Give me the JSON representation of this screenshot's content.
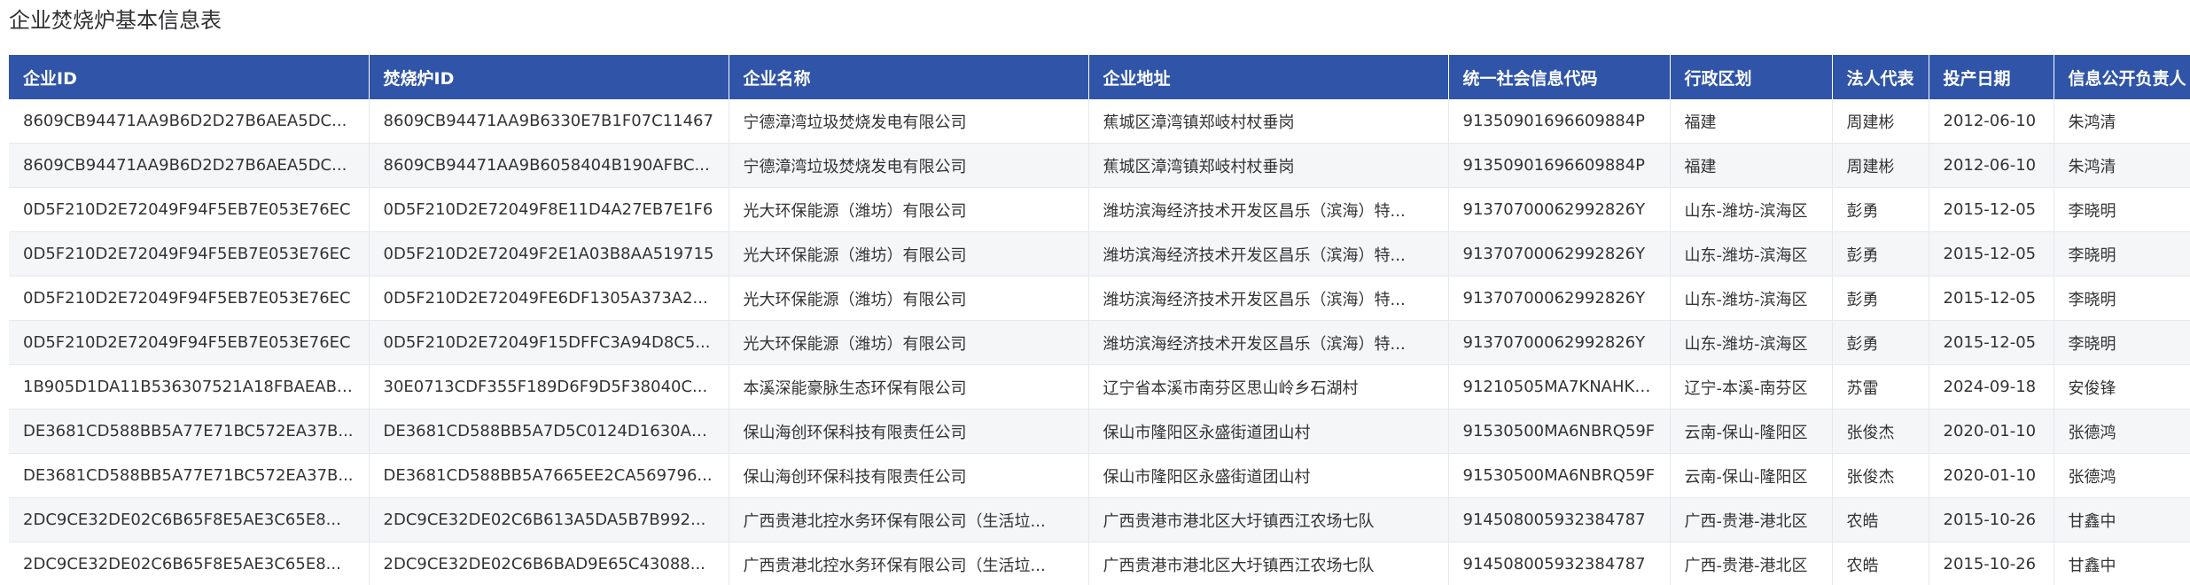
{
  "page_title": "企业焚烧炉基本信息表",
  "table": {
    "headers": [
      "企业ID",
      "焚烧炉ID",
      "企业名称",
      "企业地址",
      "统一社会信息代码",
      "行政区划",
      "法人代表",
      "投产日期",
      "信息公开负责人"
    ],
    "rows": [
      [
        "8609CB94471AA9B6D2D27B6AEA5DC...",
        "8609CB94471AA9B6330E7B1F07C11467",
        "宁德漳湾垃圾焚烧发电有限公司",
        "蕉城区漳湾镇郑岐村杖垂岗",
        "91350901696609884P",
        "福建",
        "周建彬",
        "2012-06-10",
        "朱鸿清"
      ],
      [
        "8609CB94471AA9B6D2D27B6AEA5DC...",
        "8609CB94471AA9B6058404B190AFBC...",
        "宁德漳湾垃圾焚烧发电有限公司",
        "蕉城区漳湾镇郑岐村杖垂岗",
        "91350901696609884P",
        "福建",
        "周建彬",
        "2012-06-10",
        "朱鸿清"
      ],
      [
        "0D5F210D2E72049F94F5EB7E053E76EC",
        "0D5F210D2E72049F8E11D4A27EB7E1F6",
        "光大环保能源（潍坊）有限公司",
        "潍坊滨海经济技术开发区昌乐（滨海）特...",
        "91370700062992826Y",
        "山东-潍坊-滨海区",
        "彭勇",
        "2015-12-05",
        "李晓明"
      ],
      [
        "0D5F210D2E72049F94F5EB7E053E76EC",
        "0D5F210D2E72049F2E1A03B8AA519715",
        "光大环保能源（潍坊）有限公司",
        "潍坊滨海经济技术开发区昌乐（滨海）特...",
        "91370700062992826Y",
        "山东-潍坊-滨海区",
        "彭勇",
        "2015-12-05",
        "李晓明"
      ],
      [
        "0D5F210D2E72049F94F5EB7E053E76EC",
        "0D5F210D2E72049FE6DF1305A373A2...",
        "光大环保能源（潍坊）有限公司",
        "潍坊滨海经济技术开发区昌乐（滨海）特...",
        "91370700062992826Y",
        "山东-潍坊-滨海区",
        "彭勇",
        "2015-12-05",
        "李晓明"
      ],
      [
        "0D5F210D2E72049F94F5EB7E053E76EC",
        "0D5F210D2E72049F15DFFC3A94D8C5...",
        "光大环保能源（潍坊）有限公司",
        "潍坊滨海经济技术开发区昌乐（滨海）特...",
        "91370700062992826Y",
        "山东-潍坊-滨海区",
        "彭勇",
        "2015-12-05",
        "李晓明"
      ],
      [
        "1B905D1DA11B536307521A18FBAEABE...",
        "30E0713CDF355F189D6F9D5F38040C...",
        "本溪深能豪脉生态环保有限公司",
        "辽宁省本溪市南芬区思山岭乡石湖村",
        "91210505MA7KNAHK2K",
        "辽宁-本溪-南芬区",
        "苏雷",
        "2024-09-18",
        "安俊锋"
      ],
      [
        "DE3681CD588BB5A77E71BC572EA37B...",
        "DE3681CD588BB5A7D5C0124D1630A9...",
        "保山海创环保科技有限责任公司",
        "保山市隆阳区永盛街道团山村",
        "91530500MA6NBRQ59F",
        "云南-保山-隆阳区",
        "张俊杰",
        "2020-01-10",
        "张德鸿"
      ],
      [
        "DE3681CD588BB5A77E71BC572EA37B...",
        "DE3681CD588BB5A7665EE2CA569796...",
        "保山海创环保科技有限责任公司",
        "保山市隆阳区永盛街道团山村",
        "91530500MA6NBRQ59F",
        "云南-保山-隆阳区",
        "张俊杰",
        "2020-01-10",
        "张德鸿"
      ],
      [
        "2DC9CE32DE02C6B65F8E5AE3C65E8...",
        "2DC9CE32DE02C6B613A5DA5B7B992...",
        "广西贵港北控水务环保有限公司（生活垃...",
        "广西贵港市港北区大圩镇西江农场七队",
        "91450800593238478​7",
        "广西-贵港-港北区",
        "农皓",
        "2015-10-26",
        "甘鑫中"
      ],
      [
        "2DC9CE32DE02C6B65F8E5AE3C65E8...",
        "2DC9CE32DE02C6B6BAD9E65C43088...",
        "广西贵港北控水务环保有限公司（生活垃...",
        "广西贵港市港北区大圩镇西江农场七队",
        "914508005932384787",
        "广西-贵港-港北区",
        "农皓",
        "2015-10-26",
        "甘鑫中"
      ]
    ]
  }
}
